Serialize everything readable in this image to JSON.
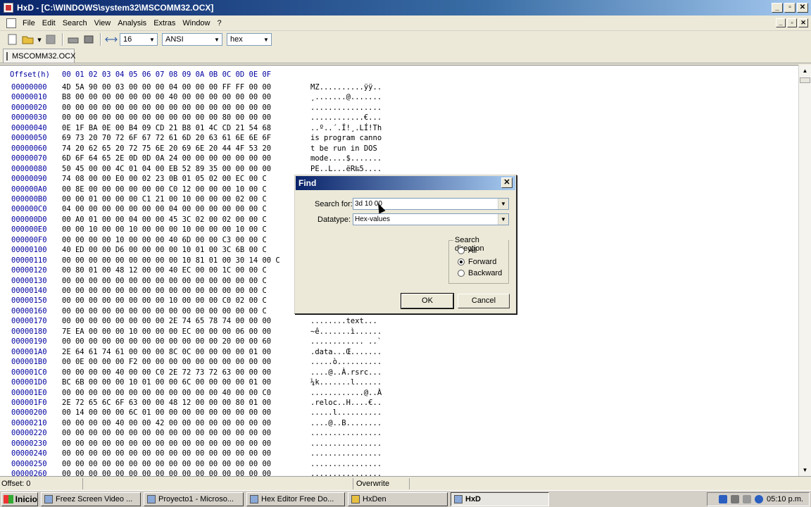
{
  "window": {
    "title": "HxD - [C:\\WINDOWS\\system32\\MSCOMM32.OCX]"
  },
  "menu": [
    "File",
    "Edit",
    "Search",
    "View",
    "Analysis",
    "Extras",
    "Window",
    "?"
  ],
  "toolbar": {
    "bytes_per_row": "16",
    "charset": "ANSI",
    "offset_base": "hex"
  },
  "tab": {
    "label": "MSCOMM32.OCX"
  },
  "hex": {
    "header_offset": "Offset(h)",
    "header_cols": "00 01 02 03 04 05 06 07 08 09 0A 0B 0C 0D 0E 0F",
    "rows": [
      {
        "off": "00000000",
        "hex": "4D 5A 90 00 03 00 00 00 04 00 00 00 FF FF 00 00",
        "txt": "MZ..........ÿÿ.."
      },
      {
        "off": "00000010",
        "hex": "B8 00 00 00 00 00 00 00 40 00 00 00 00 00 00 00",
        "txt": "¸.......@......."
      },
      {
        "off": "00000020",
        "hex": "00 00 00 00 00 00 00 00 00 00 00 00 00 00 00 00",
        "txt": "................"
      },
      {
        "off": "00000030",
        "hex": "00 00 00 00 00 00 00 00 00 00 00 00 80 00 00 00",
        "txt": "............€..."
      },
      {
        "off": "00000040",
        "hex": "0E 1F BA 0E 00 B4 09 CD 21 B8 01 4C CD 21 54 68",
        "txt": "..º..´.Í!¸.LÍ!Th"
      },
      {
        "off": "00000050",
        "hex": "69 73 20 70 72 6F 67 72 61 6D 20 63 61 6E 6E 6F",
        "txt": "is program canno"
      },
      {
        "off": "00000060",
        "hex": "74 20 62 65 20 72 75 6E 20 69 6E 20 44 4F 53 20",
        "txt": "t be run in DOS "
      },
      {
        "off": "00000070",
        "hex": "6D 6F 64 65 2E 0D 0D 0A 24 00 00 00 00 00 00 00",
        "txt": "mode....$......."
      },
      {
        "off": "00000080",
        "hex": "50 45 00 00 4C 01 04 00 EB 52 89 35 00 00 00 00",
        "txt": "PE..L...ëR‰5...."
      },
      {
        "off": "00000090",
        "hex": "74 08 00 00 E0 00 02 23 0B 01 05 02 00 EC 00 C",
        "txt": ""
      },
      {
        "off": "000000A0",
        "hex": "00 8E 00 00 00 00 00 00 C0 12 00 00 00 10 00 C",
        "txt": ""
      },
      {
        "off": "000000B0",
        "hex": "00 00 01 00 00 00 C1 21 00 10 00 00 00 02 00 C",
        "txt": ""
      },
      {
        "off": "000000C0",
        "hex": "04 00 00 00 00 00 00 00 04 00 00 00 00 00 00 C",
        "txt": ""
      },
      {
        "off": "000000D0",
        "hex": "00 A0 01 00 00 04 00 00 45 3C 02 00 02 00 00 C",
        "txt": ""
      },
      {
        "off": "000000E0",
        "hex": "00 00 10 00 00 10 00 00 00 10 00 00 00 10 00 C",
        "txt": ""
      },
      {
        "off": "000000F0",
        "hex": "00 00 00 00 10 00 00 00 40 6D 00 00 C3 00 00 C",
        "txt": ""
      },
      {
        "off": "00000100",
        "hex": "40 ED 00 00 D6 00 00 00 00 10 01 00 3C 6B 00 C",
        "txt": ""
      },
      {
        "off": "00000110",
        "hex": "00 00 00 00 00 00 00 00 00 10 81 01 00 30 14 00 C",
        "txt": ""
      },
      {
        "off": "00000120",
        "hex": "00 80 01 00 48 12 00 00 40 EC 00 00 1C 00 00 C",
        "txt": ""
      },
      {
        "off": "00000130",
        "hex": "00 00 00 00 00 00 00 00 00 00 00 00 00 00 00 C",
        "txt": ""
      },
      {
        "off": "00000140",
        "hex": "00 00 00 00 00 00 00 00 00 00 00 00 00 00 00 C",
        "txt": ""
      },
      {
        "off": "00000150",
        "hex": "00 00 00 00 00 00 00 00 10 00 00 00 C0 02 00 C",
        "txt": ""
      },
      {
        "off": "00000160",
        "hex": "00 00 00 00 00 00 00 00 00 00 00 00 00 00 00 C",
        "txt": ""
      },
      {
        "off": "00000170",
        "hex": "00 00 00 00 00 00 00 00 2E 74 65 78 74 00 00 00",
        "txt": "........text..."
      },
      {
        "off": "00000180",
        "hex": "7E EA 00 00 00 10 00 00 00 EC 00 00 00 06 00 00",
        "txt": "~ê.......ì......"
      },
      {
        "off": "00000190",
        "hex": "00 00 00 00 00 00 00 00 00 00 00 00 20 00 00 60",
        "txt": "............ ..`"
      },
      {
        "off": "000001A0",
        "hex": "2E 64 61 74 61 00 00 00 8C 0C 00 00 00 00 01 00",
        "txt": ".data...Œ......."
      },
      {
        "off": "000001B0",
        "hex": "00 0E 00 00 00 F2 00 00 00 00 00 00 00 00 00 00",
        "txt": ".....ò.........."
      },
      {
        "off": "000001C0",
        "hex": "00 00 00 00 40 00 00 C0 2E 72 73 72 63 00 00 00",
        "txt": "....@..À.rsrc..."
      },
      {
        "off": "000001D0",
        "hex": "BC 6B 00 00 00 10 01 00 00 6C 00 00 00 00 01 00",
        "txt": "¼k.......l......"
      },
      {
        "off": "000001E0",
        "hex": "00 00 00 00 00 00 00 00 00 00 00 00 40 00 00 C0",
        "txt": "............@..À"
      },
      {
        "off": "000001F0",
        "hex": "2E 72 65 6C 6F 63 00 00 48 12 00 00 00 80 01 00",
        "txt": ".reloc..H....€.."
      },
      {
        "off": "00000200",
        "hex": "00 14 00 00 00 6C 01 00 00 00 00 00 00 00 00 00",
        "txt": ".....l.........."
      },
      {
        "off": "00000210",
        "hex": "00 00 00 00 40 00 00 42 00 00 00 00 00 00 00 00",
        "txt": "....@..B........"
      },
      {
        "off": "00000220",
        "hex": "00 00 00 00 00 00 00 00 00 00 00 00 00 00 00 00",
        "txt": "................"
      },
      {
        "off": "00000230",
        "hex": "00 00 00 00 00 00 00 00 00 00 00 00 00 00 00 00",
        "txt": "................"
      },
      {
        "off": "00000240",
        "hex": "00 00 00 00 00 00 00 00 00 00 00 00 00 00 00 00",
        "txt": "................"
      },
      {
        "off": "00000250",
        "hex": "00 00 00 00 00 00 00 00 00 00 00 00 00 00 00 00",
        "txt": "................"
      },
      {
        "off": "00000260",
        "hex": "00 00 00 00 00 00 00 00 00 00 00 00 00 00 00 00",
        "txt": "................"
      }
    ]
  },
  "find_dialog": {
    "title": "Find",
    "search_label": "Search for:",
    "search_value": "3d 10 00",
    "datatype_label": "Datatype:",
    "datatype_value": "Hex-values",
    "direction_title": "Search direction",
    "directions": [
      {
        "label": "All",
        "selected": false
      },
      {
        "label": "Forward",
        "selected": true
      },
      {
        "label": "Backward",
        "selected": false
      }
    ],
    "ok_label": "OK",
    "cancel_label": "Cancel"
  },
  "status": {
    "offset": "Offset: 0",
    "mode": "Overwrite"
  },
  "taskbar": {
    "start_label": "Inicio",
    "tasks": [
      {
        "label": "Freez Screen Video ...",
        "active": false
      },
      {
        "label": "Proyecto1 - Microso...",
        "active": false
      },
      {
        "label": "Hex Editor Free Do...",
        "active": false
      },
      {
        "label": "HxDen",
        "active": false
      },
      {
        "label": "HxD",
        "active": true
      }
    ],
    "clock": "05:10 p.m."
  }
}
